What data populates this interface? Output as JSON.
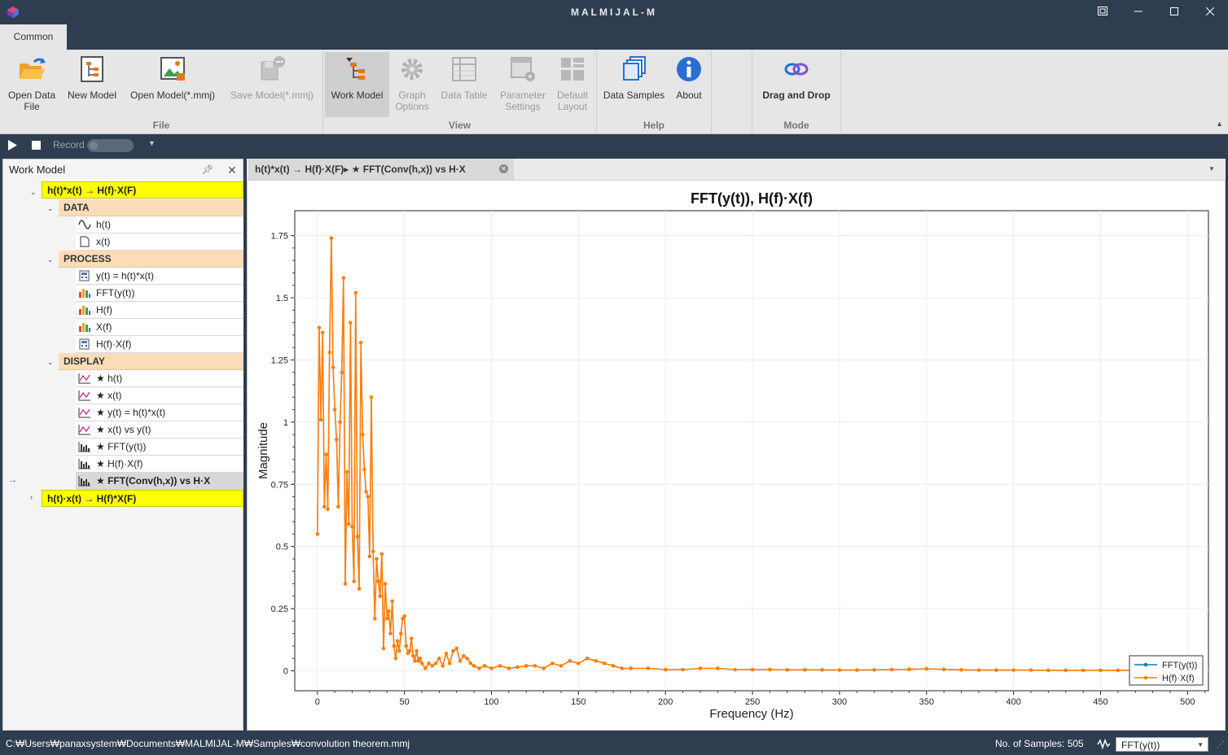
{
  "app": {
    "title": "MALMIJAL-M"
  },
  "tabs": {
    "common": "Common"
  },
  "ribbon": {
    "open_data_file": "Open Data File",
    "open_data_file_l1": "Open Data",
    "open_data_file_l2": "File",
    "new_model": "New Model",
    "open_model": "Open Model(*.mmj)",
    "save_model": "Save Model(*.mmj)",
    "work_model": "Work Model",
    "graph_options_l1": "Graph",
    "graph_options_l2": "Options",
    "data_table": "Data Table",
    "parameter_settings_l1": "Parameter",
    "parameter_settings_l2": "Settings",
    "default_layout_l1": "Default",
    "default_layout_l2": "Layout",
    "data_samples": "Data Samples",
    "about": "About",
    "drag_and_drop": "Drag and Drop",
    "groups": {
      "file": "File",
      "view": "View",
      "help": "Help",
      "mode": "Mode"
    }
  },
  "toolbar": {
    "record": "Record"
  },
  "panel": {
    "title": "Work Model",
    "tree": {
      "root1": "h(t)*x(t) → H(f)·X(F)",
      "data": "DATA",
      "data_items": [
        "h(t)",
        "x(t)"
      ],
      "process": "PROCESS",
      "process_items": [
        "y(t) = h(t)*x(t)",
        "FFT(y(t))",
        "H(f)",
        "X(f)",
        "H(f)·X(f)"
      ],
      "display": "DISPLAY",
      "display_items": [
        "★ h(t)",
        "★ x(t)",
        "★ y(t) = h(t)*x(t)",
        "★ x(t) vs y(t)",
        "★ FFT(y(t))",
        "★ H(f)·X(f)",
        "★ FFT(Conv(h,x)) vs H·X"
      ],
      "root2": "h(t)·x(t) → H(f)*X(F)"
    }
  },
  "document": {
    "tab_title": "h(t)*x(t) → H(f)·X(F)▸ ★ FFT(Conv(h,x)) vs H·X"
  },
  "chart_data": {
    "type": "line",
    "title": "FFT(y(t)), H(f)·X(f)",
    "xlabel": "Frequency (Hz)",
    "ylabel": "Magnitude",
    "xlim": [
      -13,
      512
    ],
    "ylim": [
      -0.08,
      1.85
    ],
    "xticks": [
      0,
      50,
      100,
      150,
      200,
      250,
      300,
      350,
      400,
      450,
      500
    ],
    "yticks": [
      0,
      0.25,
      0.5,
      0.75,
      1,
      1.25,
      1.5,
      1.75
    ],
    "ytick_labels": [
      "0",
      "0.25",
      "0.5",
      "0.75",
      "1",
      "1.25",
      "1.5",
      "1.75"
    ],
    "grid": true,
    "legend_position": "bottom-right",
    "series": [
      {
        "name": "FFT(y(t))",
        "color": "#1f77b4"
      },
      {
        "name": "H(f)·X(f)",
        "color": "#ff7f0e"
      }
    ],
    "x": [
      0,
      1,
      2,
      3,
      4,
      5,
      6,
      7,
      8,
      9,
      10,
      11,
      12,
      13,
      14,
      15,
      16,
      17,
      18,
      19,
      20,
      21,
      22,
      23,
      24,
      25,
      26,
      27,
      28,
      29,
      30,
      31,
      32,
      33,
      34,
      35,
      36,
      37,
      38,
      39,
      40,
      41,
      42,
      43,
      44,
      45,
      46,
      47,
      48,
      49,
      50,
      51,
      52,
      53,
      54,
      55,
      56,
      57,
      58,
      59,
      60,
      62,
      64,
      66,
      68,
      70,
      72,
      74,
      76,
      78,
      80,
      82,
      84,
      86,
      88,
      90,
      93,
      96,
      100,
      105,
      110,
      115,
      120,
      125,
      130,
      135,
      140,
      145,
      150,
      155,
      160,
      165,
      170,
      175,
      180,
      190,
      200,
      210,
      220,
      230,
      240,
      250,
      260,
      270,
      280,
      290,
      300,
      310,
      320,
      330,
      340,
      350,
      360,
      370,
      380,
      390,
      400,
      410,
      420,
      430,
      440,
      450,
      460,
      470,
      480,
      490,
      500
    ],
    "values": [
      0.55,
      1.38,
      1.01,
      1.36,
      0.66,
      0.87,
      0.65,
      1.28,
      1.74,
      1.22,
      1.05,
      0.93,
      0.66,
      1.0,
      1.2,
      1.58,
      0.35,
      0.8,
      0.59,
      1.4,
      0.58,
      0.36,
      1.52,
      0.54,
      0.33,
      1.32,
      0.95,
      0.81,
      0.72,
      0.7,
      0.46,
      1.1,
      0.48,
      0.21,
      0.45,
      0.36,
      0.3,
      0.47,
      0.09,
      0.35,
      0.21,
      0.24,
      0.15,
      0.28,
      0.1,
      0.05,
      0.12,
      0.08,
      0.15,
      0.21,
      0.22,
      0.1,
      0.07,
      0.08,
      0.13,
      0.06,
      0.04,
      0.08,
      0.04,
      0.05,
      0.03,
      0.01,
      0.03,
      0.02,
      0.03,
      0.05,
      0.02,
      0.07,
      0.03,
      0.08,
      0.09,
      0.04,
      0.06,
      0.05,
      0.03,
      0.02,
      0.01,
      0.02,
      0.01,
      0.02,
      0.01,
      0.015,
      0.02,
      0.02,
      0.01,
      0.03,
      0.02,
      0.04,
      0.03,
      0.05,
      0.04,
      0.03,
      0.02,
      0.01,
      0.01,
      0.01,
      0.005,
      0.005,
      0.01,
      0.01,
      0.005,
      0.005,
      0.005,
      0.004,
      0.004,
      0.004,
      0.003,
      0.003,
      0.004,
      0.005,
      0.006,
      0.008,
      0.006,
      0.004,
      0.003,
      0.003,
      0.003,
      0.003,
      0.002,
      0.002,
      0.002,
      0.002,
      0.002,
      0.002,
      0.002,
      0.002,
      0.002
    ]
  },
  "status": {
    "path": "C:₩Users₩panaxsystem₩Documents₩MALMIJAL-M₩Samples₩convolution theorem.mmj",
    "samples": "No. of Samples: 505",
    "select_value": "FFT(y(t))"
  }
}
